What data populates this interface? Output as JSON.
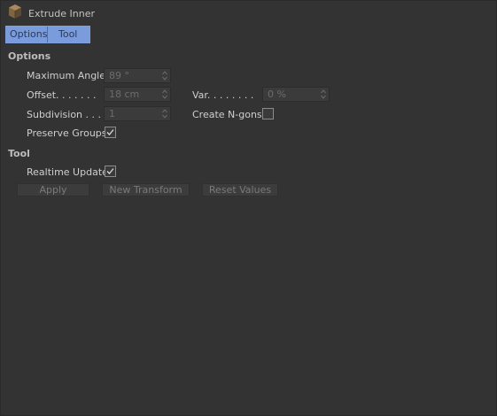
{
  "window": {
    "title": "Extrude Inner",
    "icon": "cube-icon"
  },
  "tabs": [
    {
      "label": "Options"
    },
    {
      "label": "Tool"
    }
  ],
  "options": {
    "header": "Options",
    "max_angle_label": "Maximum Angle",
    "max_angle_value": "89 °",
    "offset_label": "Offset. . . . . . .",
    "offset_value": "18 cm",
    "var_label": "Var. . . . . . . .",
    "var_value": "0 %",
    "subdivision_label": "Subdivision . . .",
    "subdivision_value": "1",
    "create_ngons_label": "Create N-gons",
    "create_ngons_checked": false,
    "preserve_groups_label": "Preserve Groups",
    "preserve_groups_checked": true
  },
  "tool": {
    "header": "Tool",
    "realtime_update_label": "Realtime Update",
    "realtime_update_checked": true,
    "apply_label": "Apply",
    "new_transform_label": "New Transform",
    "reset_values_label": "Reset Values"
  },
  "colors": {
    "background": "#333333",
    "tab_accent": "#7a9bdc"
  }
}
